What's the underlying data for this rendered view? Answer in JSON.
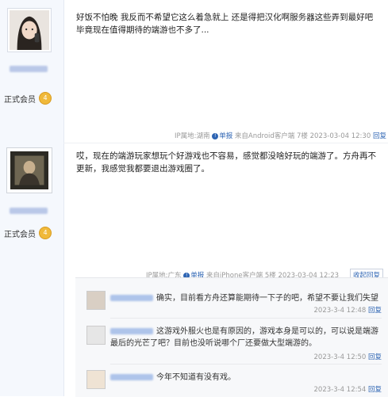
{
  "posts": [
    {
      "text": "好饭不怕晚 我反而不希望它这么着急就上 还是得把汉化啊服务器这些弄到最好吧 毕竟现在值得期待的端游也不多了...",
      "member_label": "正式会员",
      "badge": "4",
      "meta": {
        "ip": "IP属地:湖南",
        "report": "单报",
        "source": "来自Android客户端",
        "floor": "7楼",
        "time": "2023-03-04 12:30",
        "reply": "回复"
      }
    },
    {
      "text": "哎，现在的端游玩家想玩个好游戏也不容易，感觉都没啥好玩的端游了。方舟再不更新，我感觉我都要退出游戏圈了。",
      "member_label": "正式会员",
      "badge": "4",
      "meta": {
        "ip": "IP属地:广东",
        "report": "单报",
        "source": "来自iPhone客户端",
        "floor": "5楼",
        "time": "2023-03-04 12:23",
        "collapse": "收起回复"
      }
    }
  ],
  "replies": [
    {
      "text": "确实，目前看方舟还算能期待一下子的吧，希望不要让我们失望",
      "time": "2023-3-4 12:48",
      "reply": "回复"
    },
    {
      "text": "这游戏外服火也是有原因的，游戏本身是可以的，可以说是端游最后的光芒了吧？目前也没听说哪个厂还要做大型端游的。",
      "time": "2023-3-4 12:50",
      "reply": "回复"
    },
    {
      "text": "今年不知道有没有戏。",
      "time": "2023-3-4 12:54",
      "reply": "回复"
    }
  ],
  "colors": {
    "link": "#2d64b3",
    "sidebar_bg": "#f5f8fd",
    "badge": "#f0b93a"
  }
}
